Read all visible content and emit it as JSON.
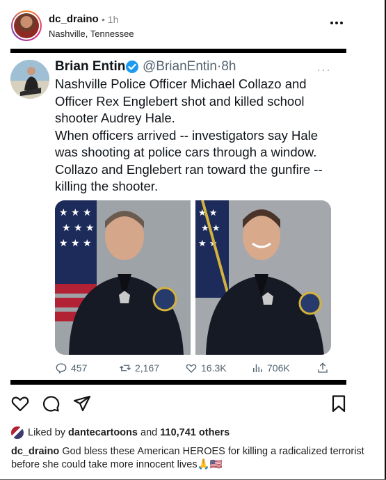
{
  "post": {
    "username": "dc_draino",
    "time": "1h",
    "separator": "•",
    "location": "Nashville, Tennessee",
    "more_icon": "more-horizontal-icon"
  },
  "tweet": {
    "name": "Brian Entin",
    "handle": "@BrianEntin",
    "separator": "·",
    "time": "8h",
    "more": "···",
    "text_lines": [
      "Nashville Police Officer Michael Collazo and",
      "Officer Rex Englebert shot and killed school",
      "shooter Audrey Hale.",
      "When officers arrived -- investigators say Hale",
      "was shooting at police cars through a window.",
      "Collazo and Englebert ran toward the gunfire --",
      "killing the shooter."
    ],
    "replies": "457",
    "retweets": "2,167",
    "likes": "16.3K",
    "views": "706K",
    "colors": {
      "verified": "#1d9bf0",
      "text": "#0f1419",
      "muted": "#536471"
    }
  },
  "actions": {
    "icons": [
      "heart-icon",
      "comment-icon",
      "share-icon",
      "bookmark-icon"
    ]
  },
  "likes": {
    "prefix": "Liked by",
    "user": "dantecartoons",
    "middle": "and",
    "count": "110,741 others"
  },
  "caption": {
    "username": "dc_draino",
    "text": "God bless these American HEROES for killing a radicalized terrorist before she could take more innocent lives",
    "emoji": "🙏🇺🇸"
  }
}
